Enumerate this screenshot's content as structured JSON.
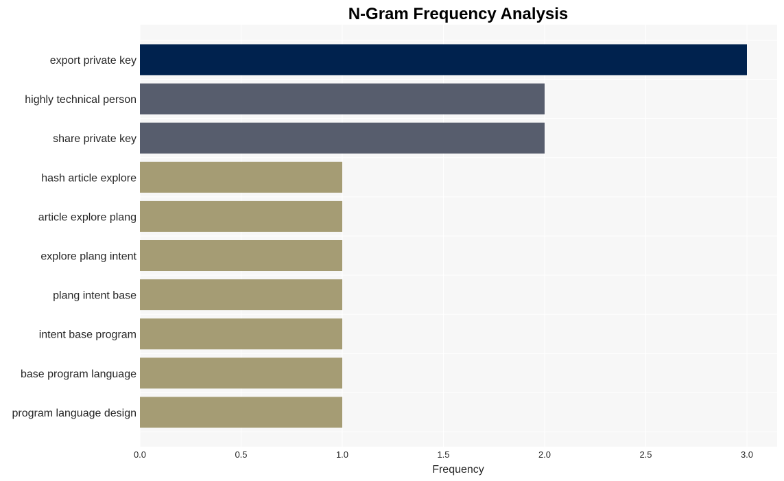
{
  "chart_data": {
    "type": "bar",
    "orientation": "horizontal",
    "title": "N-Gram Frequency Analysis",
    "xlabel": "Frequency",
    "ylabel": "",
    "xlim": [
      0,
      3.15
    ],
    "xticks": [
      0.0,
      0.5,
      1.0,
      1.5,
      2.0,
      2.5,
      3.0
    ],
    "xtick_labels": [
      "0.0",
      "0.5",
      "1.0",
      "1.5",
      "2.0",
      "2.5",
      "3.0"
    ],
    "grid": true,
    "legend": "none",
    "categories": [
      "export private key",
      "highly technical person",
      "share private key",
      "hash article explore",
      "article explore plang",
      "explore plang intent",
      "plang intent base",
      "intent base program",
      "base program language",
      "program language design"
    ],
    "values": [
      3,
      2,
      2,
      1,
      1,
      1,
      1,
      1,
      1,
      1
    ],
    "bar_colors": [
      "#00224e",
      "#575d6d",
      "#575d6d",
      "#a59c74",
      "#a59c74",
      "#a59c74",
      "#a59c74",
      "#a59c74",
      "#a59c74",
      "#a59c74"
    ],
    "background_color": "#f7f7f7",
    "grid_color": "#ffffff"
  }
}
